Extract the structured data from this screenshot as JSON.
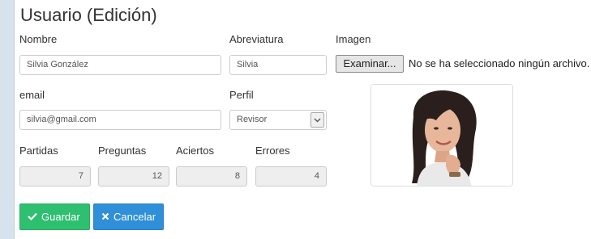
{
  "form": {
    "title": "Usuario (Edición)",
    "labels": {
      "nombre": "Nombre",
      "abreviatura": "Abreviatura",
      "imagen": "Imagen",
      "email": "email",
      "perfil": "Perfil",
      "partidas": "Partidas",
      "preguntas": "Preguntas",
      "aciertos": "Aciertos",
      "errores": "Errores"
    },
    "values": {
      "nombre": "Silvia González",
      "abreviatura": "Silvia",
      "email": "silvia@gmail.com",
      "perfil": "Revisor",
      "partidas": "7",
      "preguntas": "12",
      "aciertos": "8",
      "errores": "4"
    },
    "file": {
      "button_label": "Examinar...",
      "status": "No se ha seleccionado ningún archivo."
    },
    "buttons": {
      "save": "Guardar",
      "cancel": "Cancelar"
    }
  },
  "colors": {
    "save": "#2fbf71",
    "cancel": "#2f8fd8",
    "background": "#d6e2ec"
  },
  "icons": {
    "save": "check-icon",
    "cancel": "times-icon",
    "select": "chevron-down-icon"
  }
}
